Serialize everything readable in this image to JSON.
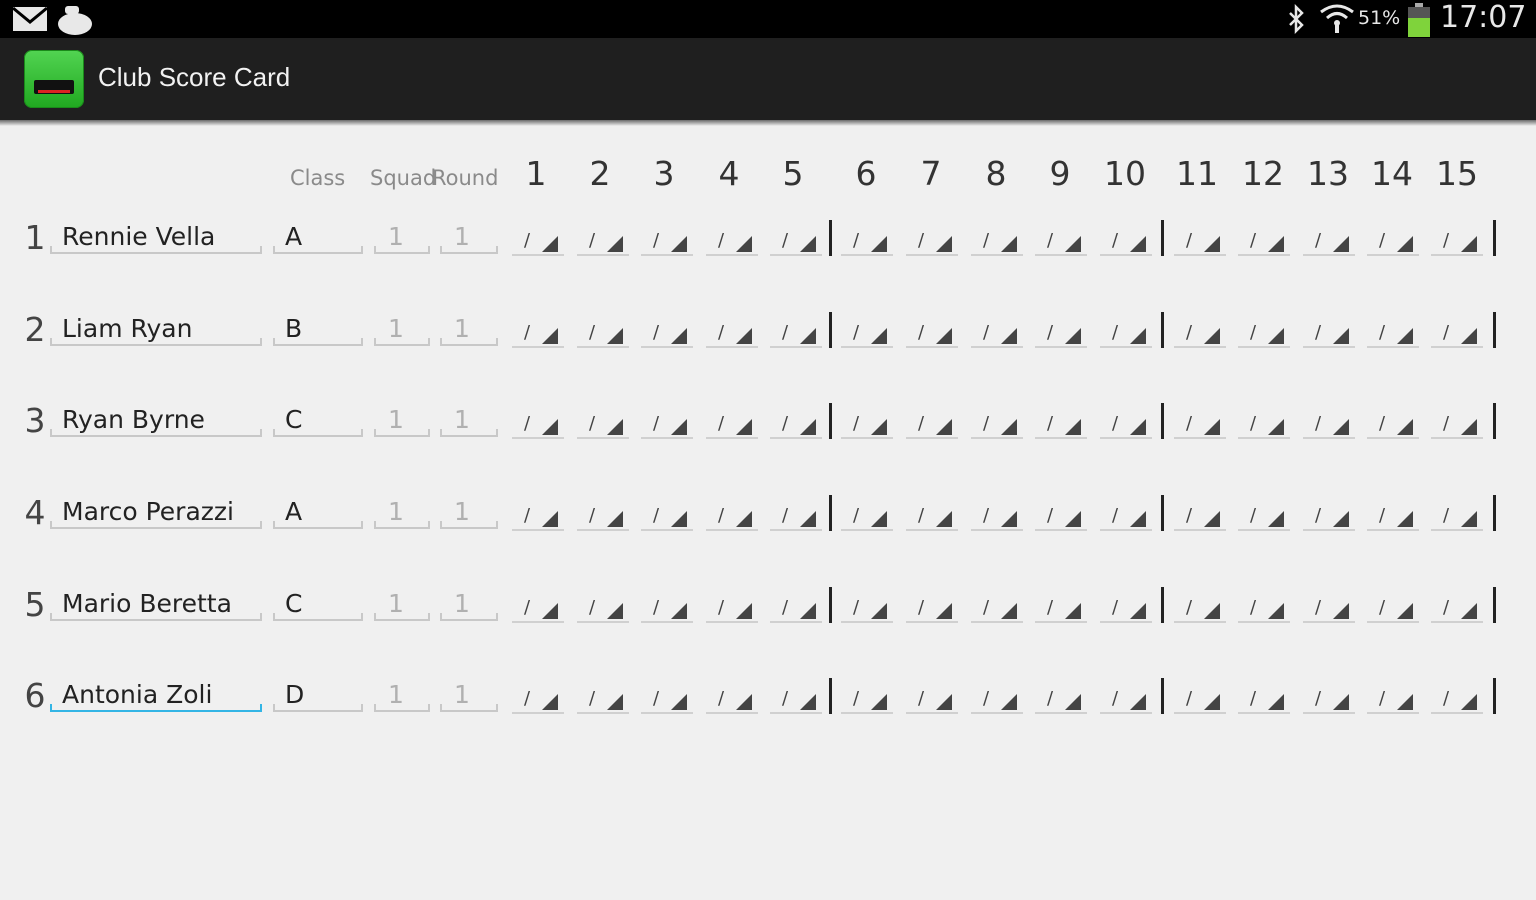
{
  "status_bar": {
    "battery_percent": "51%",
    "clock": "17:07",
    "icons": [
      "gmail-icon",
      "notification-icon",
      "bluetooth-icon",
      "wifi-icon",
      "battery-icon"
    ]
  },
  "action_bar": {
    "title": "Club Score Card",
    "icon": "app-icon"
  },
  "table": {
    "headers": {
      "class": "Class",
      "squad": "Squad",
      "round": "Round"
    },
    "stands": [
      "1",
      "2",
      "3",
      "4",
      "5",
      "6",
      "7",
      "8",
      "9",
      "10",
      "11",
      "12",
      "13",
      "14",
      "15"
    ],
    "shot_mark": "/",
    "rows": [
      {
        "num": "1",
        "name": "Rennie Vella",
        "class": "A",
        "squad": "1",
        "round": "1"
      },
      {
        "num": "2",
        "name": "Liam Ryan",
        "class": "B",
        "squad": "1",
        "round": "1"
      },
      {
        "num": "3",
        "name": "Ryan Byrne",
        "class": "C",
        "squad": "1",
        "round": "1"
      },
      {
        "num": "4",
        "name": "Marco Perazzi",
        "class": "A",
        "squad": "1",
        "round": "1"
      },
      {
        "num": "5",
        "name": "Mario Beretta",
        "class": "C",
        "squad": "1",
        "round": "1"
      },
      {
        "num": "6",
        "name": "Antonia Zoli",
        "class": "D",
        "squad": "1",
        "round": "1"
      }
    ],
    "focused_row": 5
  },
  "colors": {
    "accent": "#33b5e5",
    "battery": "#7fd33b"
  }
}
